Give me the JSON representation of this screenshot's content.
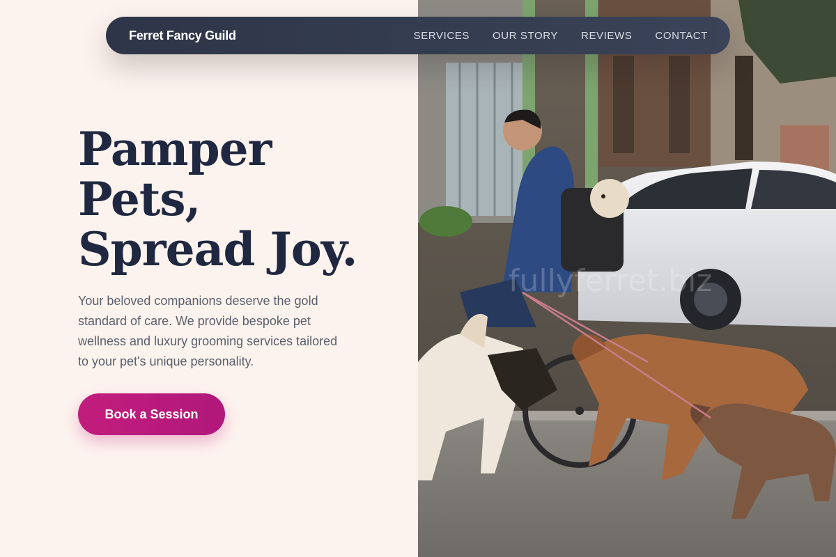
{
  "nav": {
    "brand": "Ferret Fancy Guild",
    "links": [
      "SERVICES",
      "OUR STORY",
      "REVIEWS",
      "CONTACT"
    ]
  },
  "hero": {
    "headline": [
      "Pamper",
      "Pets,",
      "Spread Joy."
    ],
    "subcopy": "Your beloved companions deserve the gold standard of care. We provide bespoke pet wellness and luxury grooming services tailored to your pet's unique personality.",
    "cta_label": "Book a Session"
  },
  "photo": {
    "watermark": "fullyferret.biz"
  },
  "colors": {
    "background": "#fdf3ee",
    "heading": "#1f2840",
    "body_text": "#5a5f6b",
    "accent": "#c21d7d",
    "nav_background": "#2e3548"
  }
}
